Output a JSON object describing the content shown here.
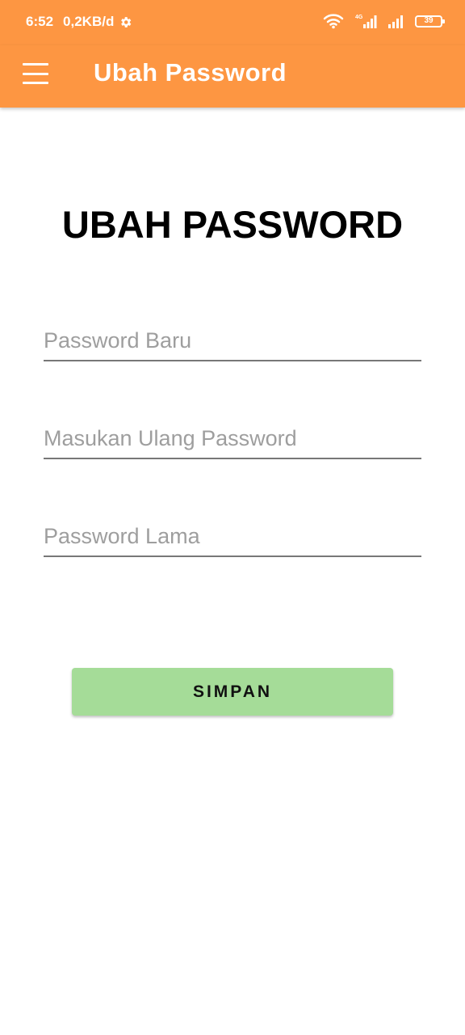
{
  "status_bar": {
    "time": "6:52",
    "data_rate": "0,2KB/d",
    "battery_level": "39",
    "icons": [
      "settings-gear-icon",
      "wifi-icon",
      "signal-4g-icon",
      "signal-icon",
      "battery-icon"
    ]
  },
  "app_bar": {
    "menu_icon": "hamburger-menu-icon",
    "title": "Ubah Password",
    "background": "#fd9642"
  },
  "form": {
    "heading": "UBAH PASSWORD",
    "new_password": {
      "value": "",
      "placeholder": "Password Baru"
    },
    "confirm_password": {
      "value": "",
      "placeholder": "Masukan Ulang Password"
    },
    "old_password": {
      "value": "",
      "placeholder": "Password Lama"
    },
    "save_label": "SIMPAN",
    "save_color": "#a5dc98"
  }
}
